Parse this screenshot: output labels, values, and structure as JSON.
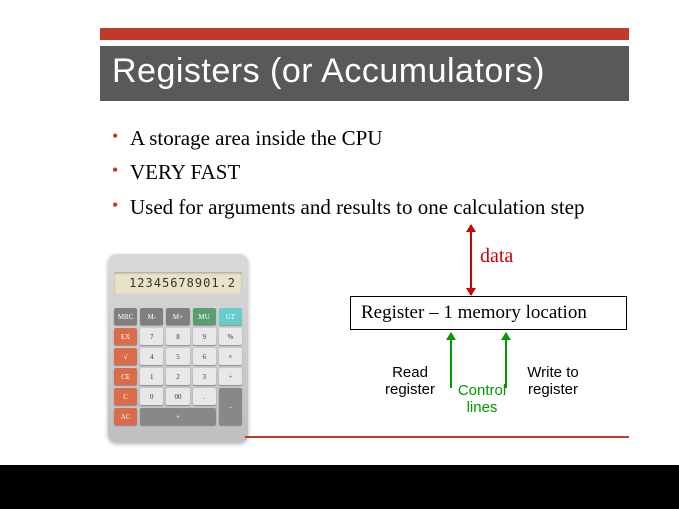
{
  "title": "Registers (or Accumulators)",
  "bullets": {
    "b1": "A storage area inside the CPU",
    "b2": "VERY FAST",
    "b3": "Used for arguments and results to one calculation step"
  },
  "calc": {
    "screen": "12345678901.2"
  },
  "diagram": {
    "data": "data",
    "register": "Register – 1 memory location",
    "read": "Read register",
    "write": "Write to register",
    "control": "Control lines"
  }
}
